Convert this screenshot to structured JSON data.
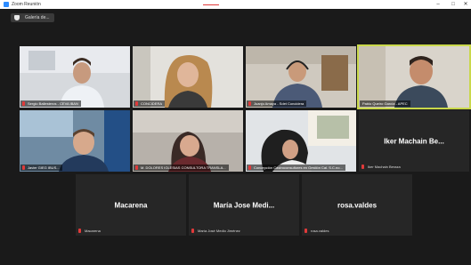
{
  "window": {
    "title": "Zoom Reunión",
    "minimize": "–",
    "maximize": "□",
    "close": "✕"
  },
  "toolbar": {
    "gallery_label": "Galería de..."
  },
  "participants": [
    {
      "name": "Sergio Ballesteros - CEVA IBAN"
    },
    {
      "name": "CONCIDERA"
    },
    {
      "name": "Juanjo Amaya - Sdet Concidera"
    },
    {
      "name": "Pablo Queiro García - APEC"
    },
    {
      "name": "Javier GIEG IBUS..."
    },
    {
      "name": "M. DOLORES IGLESIAS CONSULTORA TRANSLA..."
    },
    {
      "name": "Concepción Castroconsultores en Gestión Cal. S.C.no..."
    },
    {
      "name": "Iker Machain Be...",
      "subname": "Iker Machain Beraza"
    },
    {
      "name": "Macarena",
      "subname": "Macarena"
    },
    {
      "name": "María Jose Medi...",
      "subname": "María José Medio Jiménez"
    },
    {
      "name": "rosa.valdes",
      "subname": "rosa.valdes"
    }
  ],
  "colors": {
    "active_speaker": "#c9d84a",
    "muted": "#e03a3a"
  }
}
